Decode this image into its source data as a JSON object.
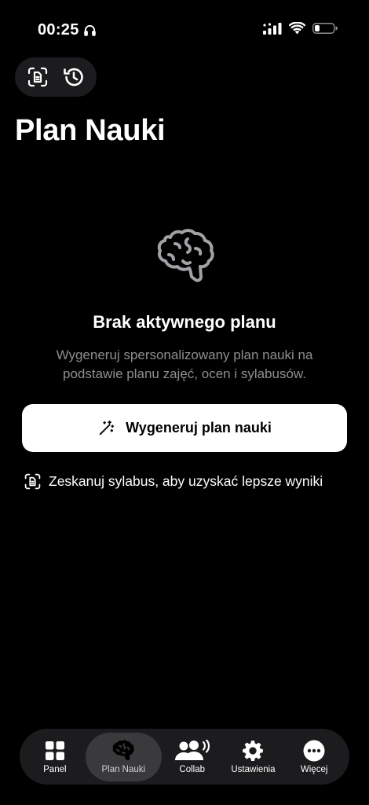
{
  "status_bar": {
    "time": "00:25"
  },
  "page": {
    "title": "Plan Nauki"
  },
  "empty_state": {
    "title": "Brak aktywnego planu",
    "description": "Wygeneruj spersonalizowany plan nauki na podstawie planu zajęć, ocen i sylabusów."
  },
  "actions": {
    "generate_label": "Wygeneruj plan nauki",
    "scan_label": "Zeskanuj sylabus, aby uzyskać lepsze wyniki"
  },
  "tab_bar": {
    "items": [
      {
        "label": "Panel",
        "icon": "grid-icon"
      },
      {
        "label": "Plan Nauki",
        "icon": "brain-icon",
        "active": true
      },
      {
        "label": "Collab",
        "icon": "people-icon"
      },
      {
        "label": "Ustawienia",
        "icon": "gear-icon"
      },
      {
        "label": "Więcej",
        "icon": "more-icon"
      }
    ]
  },
  "colors": {
    "background": "#000000",
    "surface": "#1c1c1e",
    "active_tab": "#3a3a3c",
    "muted_text": "#8e8e93",
    "primary_button": "#ffffff"
  }
}
